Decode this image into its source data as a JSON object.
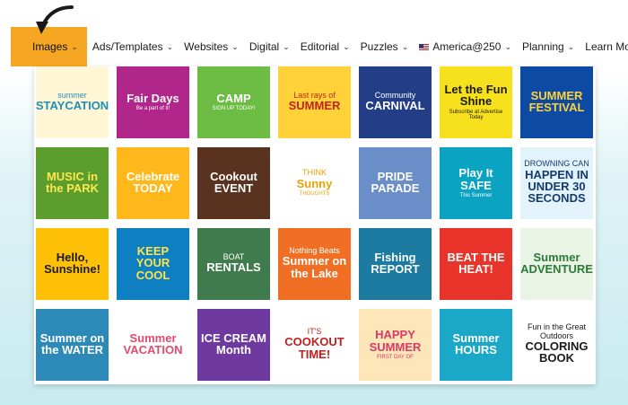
{
  "nav": {
    "items": [
      {
        "label": "Images",
        "chevron": "⌄",
        "active": true
      },
      {
        "label": "Ads/Templates",
        "chevron": "⌄"
      },
      {
        "label": "Websites",
        "chevron": "⌄"
      },
      {
        "label": "Digital",
        "chevron": "⌄"
      },
      {
        "label": "Editorial",
        "chevron": "⌄"
      },
      {
        "label": "Puzzles",
        "chevron": "⌄"
      },
      {
        "label": "America@250",
        "chevron": "⌄",
        "flag": true
      },
      {
        "label": "Planning",
        "chevron": "⌄"
      },
      {
        "label": "Learn More",
        "chevron": "⌄"
      }
    ]
  },
  "tiles": [
    {
      "l1": "summer",
      "l2": "STAYCATION",
      "l3": "",
      "bg": "#fff6d6",
      "fg": "#1f8fb8"
    },
    {
      "l1": "",
      "l2": "Fair Days",
      "l3": "Be a part of it!",
      "bg": "#b0268a",
      "fg": "#ffffff"
    },
    {
      "l1": "",
      "l2": "CAMP",
      "l3": "SIGN UP TODAY!",
      "bg": "#6dbd45",
      "fg": "#ffffff"
    },
    {
      "l1": "Last rays of",
      "l2": "SUMMER",
      "l3": "",
      "bg": "#ffd23a",
      "fg": "#c2241c"
    },
    {
      "l1": "Community",
      "l2": "CARNIVAL",
      "l3": "",
      "bg": "#233e86",
      "fg": "#ffffff"
    },
    {
      "l1": "",
      "l2": "Let the Fun Shine",
      "l3": "Subscribe at Advertise Today",
      "bg": "#f7e11c",
      "fg": "#1a1a1a"
    },
    {
      "l1": "",
      "l2": "SUMMER FESTIVAL",
      "l3": "",
      "bg": "#0d4aa3",
      "fg": "#ffd23a"
    },
    {
      "l1": "",
      "l2": "MUSIC in the PARK",
      "l3": "",
      "bg": "#5c9e2e",
      "fg": "#ffe64d"
    },
    {
      "l1": "",
      "l2": "Celebrate TODAY",
      "l3": "",
      "bg": "#ffb81c",
      "fg": "#ffffff"
    },
    {
      "l1": "",
      "l2": "Cookout EVENT",
      "l3": "",
      "bg": "#5a3320",
      "fg": "#ffffff"
    },
    {
      "l1": "THINK",
      "l2": "Sunny",
      "l3": "THOUGHTS",
      "bg": "#ffffff",
      "fg": "#e8a400"
    },
    {
      "l1": "",
      "l2": "PRIDE PARADE",
      "l3": "",
      "bg": "#6a8fc8",
      "fg": "#ffffff"
    },
    {
      "l1": "",
      "l2": "Play It SAFE",
      "l3": "This Summer",
      "bg": "#0aa3c2",
      "fg": "#ffffff"
    },
    {
      "l1": "DROWNING CAN",
      "l2": "HAPPEN IN UNDER 30 SECONDS",
      "l3": "",
      "bg": "#e3f3fb",
      "fg": "#143a6e"
    },
    {
      "l1": "",
      "l2": "Hello, Sunshine!",
      "l3": "",
      "bg": "#ffc107",
      "fg": "#1a1a1a"
    },
    {
      "l1": "",
      "l2": "KEEP YOUR COOL",
      "l3": "",
      "bg": "#0e7fc0",
      "fg": "#ffe34a"
    },
    {
      "l1": "BOAT",
      "l2": "RENTALS",
      "l3": "",
      "bg": "#3f7b4c",
      "fg": "#ffffff"
    },
    {
      "l1": "Nothing Beats",
      "l2": "Summer on the Lake",
      "l3": "",
      "bg": "#f06f25",
      "fg": "#ffffff"
    },
    {
      "l1": "",
      "l2": "Fishing REPORT",
      "l3": "",
      "bg": "#1d7aa0",
      "fg": "#ffffff"
    },
    {
      "l1": "",
      "l2": "BEAT THE HEAT!",
      "l3": "",
      "bg": "#e8342a",
      "fg": "#ffffff"
    },
    {
      "l1": "",
      "l2": "Summer ADVENTURE",
      "l3": "",
      "bg": "#eaf4e4",
      "fg": "#2a7a3a"
    },
    {
      "l1": "",
      "l2": "Summer on the WATER",
      "l3": "",
      "bg": "#2d8ab8",
      "fg": "#ffffff"
    },
    {
      "l1": "",
      "l2": "Summer VACATION",
      "l3": "",
      "bg": "#ffffff",
      "fg": "#e24a6e"
    },
    {
      "l1": "",
      "l2": "ICE CREAM Month",
      "l3": "",
      "bg": "#6e3aa0",
      "fg": "#ffffff"
    },
    {
      "l1": "IT'S",
      "l2": "COOKOUT TIME!",
      "l3": "",
      "bg": "#ffffff",
      "fg": "#c31e1e"
    },
    {
      "l1": "",
      "l2": "HAPPY SUMMER",
      "l3": "FIRST DAY OF",
      "bg": "#fde6b8",
      "fg": "#d93a6a"
    },
    {
      "l1": "",
      "l2": "Summer HOURS",
      "l3": "",
      "bg": "#1aa7c8",
      "fg": "#ffffff"
    },
    {
      "l1": "Fun in the Great Outdoors",
      "l2": "COLORING BOOK",
      "l3": "",
      "bg": "#ffffff",
      "fg": "#1a1a1a"
    }
  ]
}
